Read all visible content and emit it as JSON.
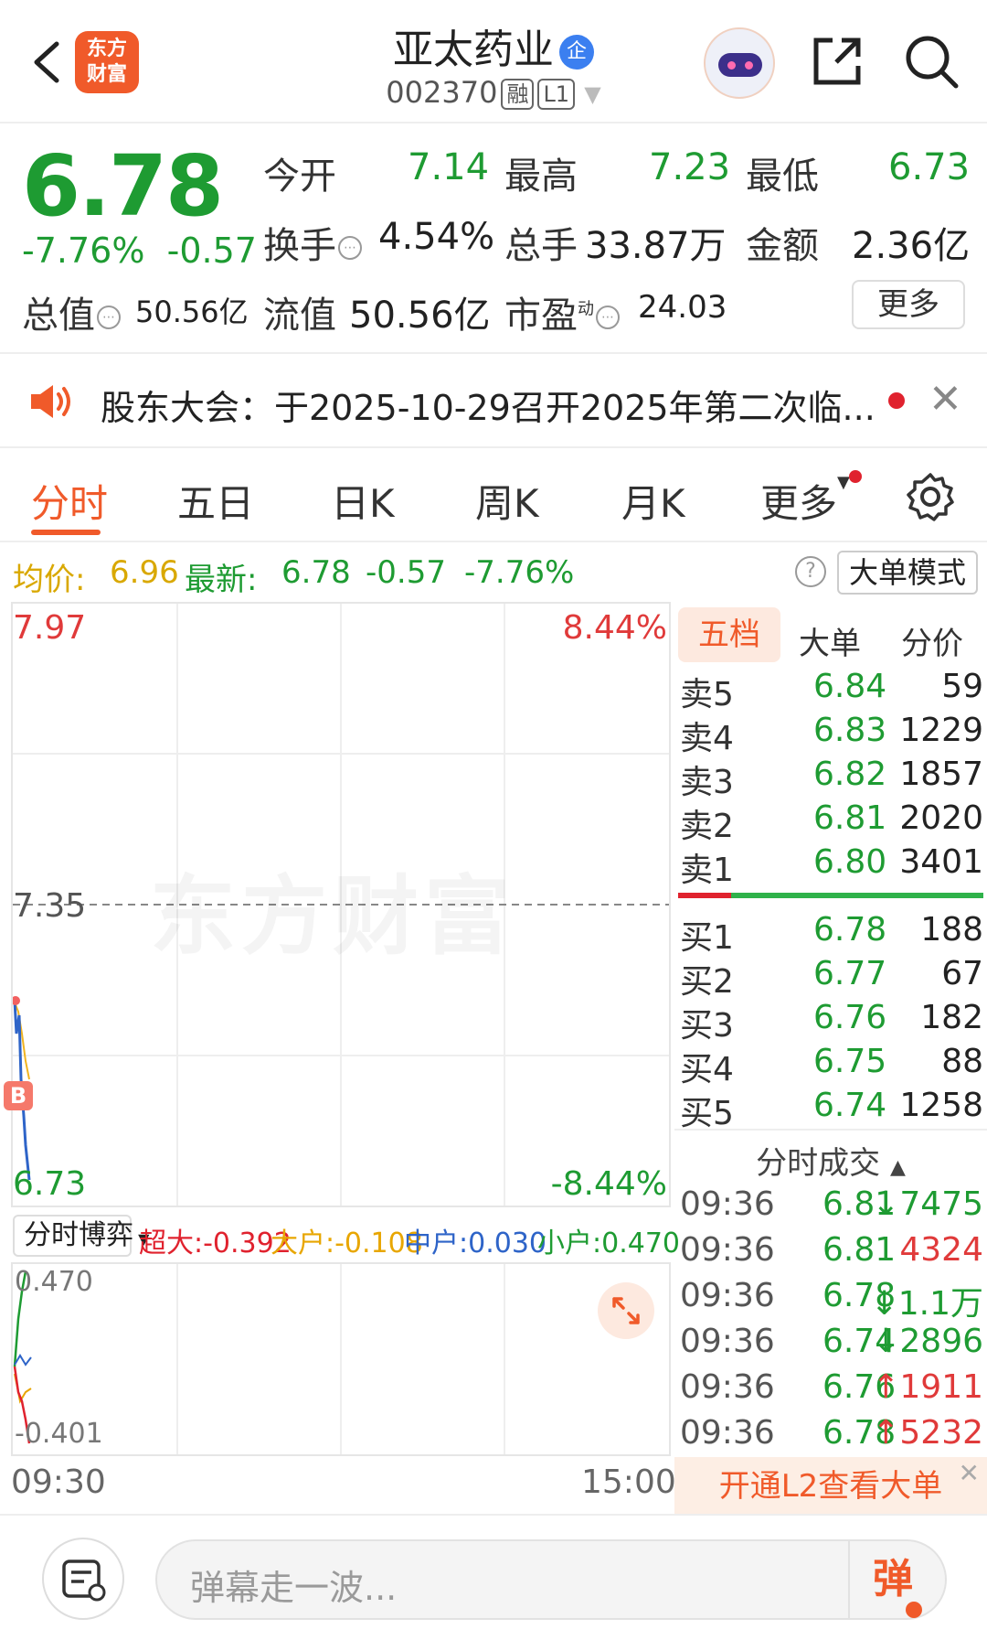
{
  "header": {
    "logo_line1": "东方",
    "logo_line2": "财富",
    "stock_name": "亚太药业",
    "name_badge": "企",
    "stock_code": "002370",
    "tag_margin": "融",
    "tag_level": "L1"
  },
  "quote": {
    "price": "6.78",
    "change_pct": "-7.76%",
    "change_amt": "-0.57",
    "open_label": "今开",
    "open_value": "7.14",
    "high_label": "最高",
    "high_value": "7.23",
    "low_label": "最低",
    "low_value": "6.73",
    "turnover_label": "换手",
    "turnover_value": "4.54%",
    "volume_label": "总手",
    "volume_value": "33.87万",
    "amount_label": "金额",
    "amount_value": "2.36亿",
    "mktcap_label": "总值",
    "mktcap_value": "50.56亿",
    "float_label": "流值",
    "float_value": "50.56亿",
    "pe_label": "市盈",
    "pe_sup": "动",
    "pe_value": "24.03",
    "more_label": "更多"
  },
  "notice": {
    "text": "股东大会：于2025-10-29召开2025年第二次临..."
  },
  "tabs": [
    {
      "label": "分时"
    },
    {
      "label": "五日"
    },
    {
      "label": "日K"
    },
    {
      "label": "周K"
    },
    {
      "label": "月K"
    },
    {
      "label": "更多"
    }
  ],
  "strip": {
    "avg_label": "均价:",
    "avg_value": "6.96",
    "latest_label": "最新:",
    "latest_value": "6.78",
    "latest_chg": "-0.57",
    "latest_pct": "-7.76%",
    "mode_label": "大单模式"
  },
  "chart": {
    "y_top": "7.97",
    "y_mid": "7.35",
    "y_bottom": "6.73",
    "pct_top": "8.44%",
    "pct_bottom": "-8.44%",
    "watermark": "东方财富",
    "buy_marker": "B",
    "x_start": "09:30",
    "x_end": "15:00",
    "indicator_label": "分时博弈",
    "super_label": "超大:-0.392",
    "large_label": "大户:-0.108",
    "mid_label": "中户:0.030",
    "small_label": "小户:0.470",
    "sub_top": "0.470",
    "sub_bottom": "-0.401"
  },
  "order_book": {
    "tabs": [
      "五档",
      "大单",
      "分价"
    ],
    "asks": [
      {
        "label": "卖5",
        "price": "6.84",
        "vol": "59"
      },
      {
        "label": "卖4",
        "price": "6.83",
        "vol": "1229"
      },
      {
        "label": "卖3",
        "price": "6.82",
        "vol": "1857"
      },
      {
        "label": "卖2",
        "price": "6.81",
        "vol": "2020"
      },
      {
        "label": "卖1",
        "price": "6.80",
        "vol": "3401"
      }
    ],
    "bids": [
      {
        "label": "买1",
        "price": "6.78",
        "vol": "188"
      },
      {
        "label": "买2",
        "price": "6.77",
        "vol": "67"
      },
      {
        "label": "买3",
        "price": "6.76",
        "vol": "182"
      },
      {
        "label": "买4",
        "price": "6.75",
        "vol": "88"
      },
      {
        "label": "买5",
        "price": "6.74",
        "vol": "1258"
      }
    ],
    "trades_title": "分时成交",
    "trades": [
      {
        "time": "09:36",
        "price": "6.81",
        "vol": "↓7475",
        "color": "#1e9b32"
      },
      {
        "time": "09:36",
        "price": "6.81",
        "vol": "4324",
        "color": "#e03a3a"
      },
      {
        "time": "09:36",
        "price": "6.78",
        "vol": "↓1.1万",
        "color": "#1e9b32"
      },
      {
        "time": "09:36",
        "price": "6.74",
        "vol": "↓2896",
        "color": "#1e9b32"
      },
      {
        "time": "09:36",
        "price": "6.76",
        "vol": "↑1911",
        "color": "#e03a3a"
      },
      {
        "time": "09:36",
        "price": "6.78",
        "vol": "↑5232",
        "color": "#e03a3a"
      }
    ],
    "l2_label": "开通L2查看大单"
  },
  "bottom": {
    "danmu_placeholder": "弹幕走一波...",
    "dan_label": "弹"
  },
  "colors": {
    "accent": "#f05a2a",
    "down": "#1e9b32",
    "up": "#e03a3a"
  }
}
